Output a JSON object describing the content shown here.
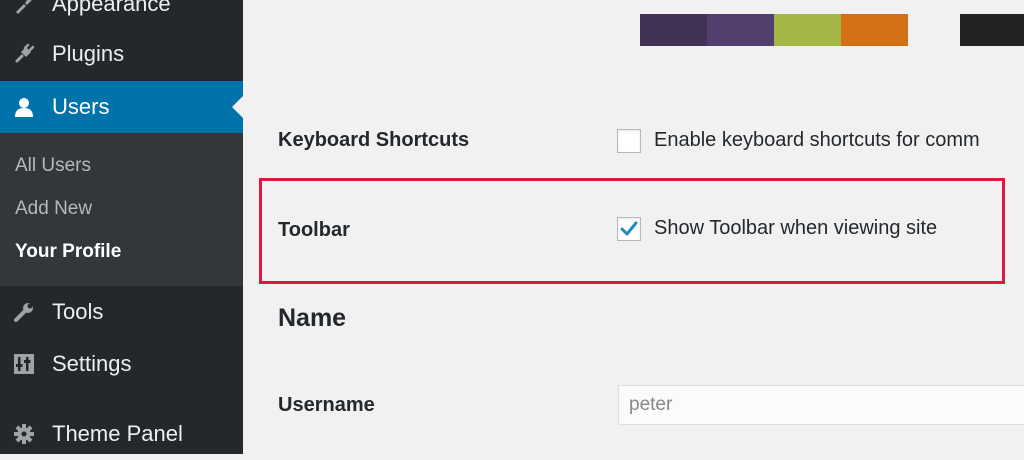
{
  "sidebar": {
    "items": [
      {
        "label": "Appearance",
        "icon": "paintbrush-icon"
      },
      {
        "label": "Plugins",
        "icon": "plug-icon"
      },
      {
        "label": "Users",
        "icon": "user-icon",
        "active": true
      },
      {
        "label": "Tools",
        "icon": "wrench-icon"
      },
      {
        "label": "Settings",
        "icon": "settings-icon"
      },
      {
        "label": "Theme Panel",
        "icon": "gear-icon"
      }
    ],
    "submenu": [
      {
        "label": "All Users"
      },
      {
        "label": "Add New"
      },
      {
        "label": "Your Profile",
        "current": true
      }
    ]
  },
  "admin_color_scheme": {
    "swatches": [
      "#413256",
      "#523f6d",
      "#a3b745",
      "#d46f15"
    ],
    "next_swatch": "#222222"
  },
  "profile": {
    "keyboard_shortcuts": {
      "label": "Keyboard Shortcuts",
      "checkbox_text": "Enable keyboard shortcuts for comm",
      "checked": false
    },
    "toolbar": {
      "label": "Toolbar",
      "checkbox_text": "Show Toolbar when viewing site",
      "checked": true
    },
    "name_section": {
      "heading": "Name",
      "username_label": "Username",
      "username_value": "peter"
    }
  },
  "colors": {
    "sidebar_bg": "#23282d",
    "submenu_bg": "#32373c",
    "active_bg": "#0073aa",
    "highlight_border": "#e1163c",
    "checkmark": "#1e8cbe"
  }
}
